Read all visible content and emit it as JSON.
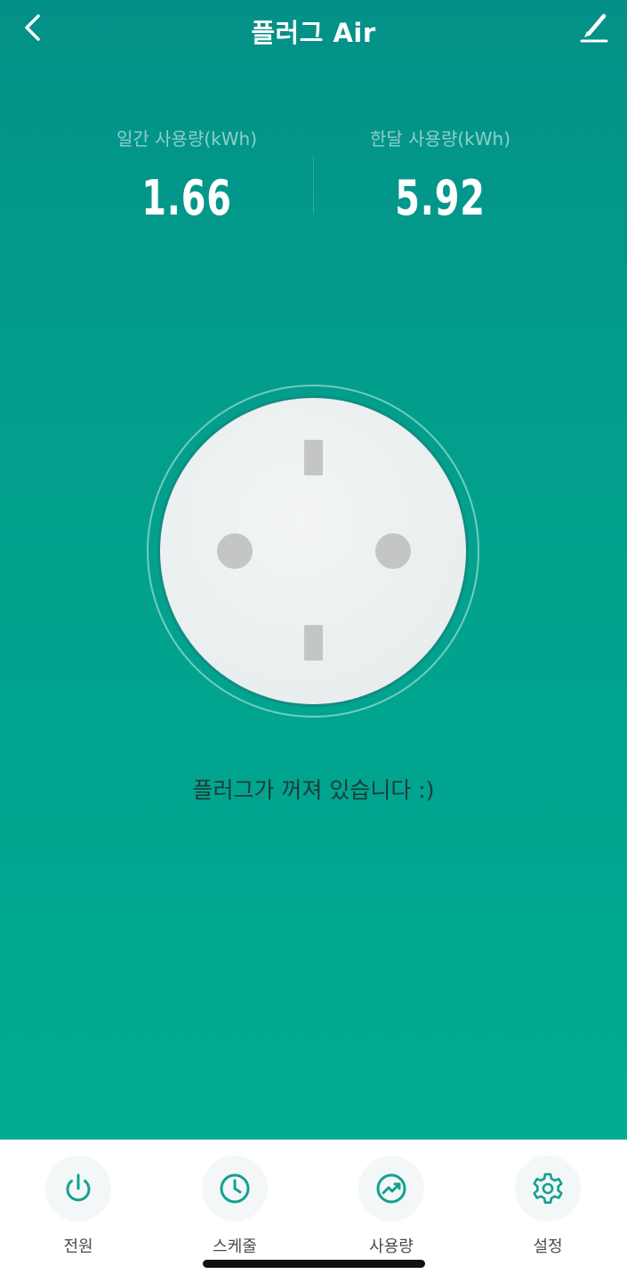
{
  "header": {
    "title": "플러그 Air",
    "back_icon": "chevron-left-icon",
    "edit_icon": "pencil-icon"
  },
  "stats": {
    "daily": {
      "label": "일간 사용량(kWh)",
      "value": "1.66"
    },
    "monthly": {
      "label": "한달 사용량(kWh)",
      "value": "5.92"
    }
  },
  "device": {
    "status_text": "플러그가 꺼져 있습니다 :)"
  },
  "tabbar": {
    "items": [
      {
        "label": "전원",
        "icon": "power-icon"
      },
      {
        "label": "스케줄",
        "icon": "clock-icon"
      },
      {
        "label": "사용량",
        "icon": "trend-chart-icon"
      },
      {
        "label": "설정",
        "icon": "gear-icon"
      }
    ]
  },
  "colors": {
    "background_top": "#039088",
    "background_bottom": "#00ad92",
    "accent": "#13a08f",
    "outlet_face": "#e9eeee",
    "outlet_slot": "#c4c6c6"
  }
}
